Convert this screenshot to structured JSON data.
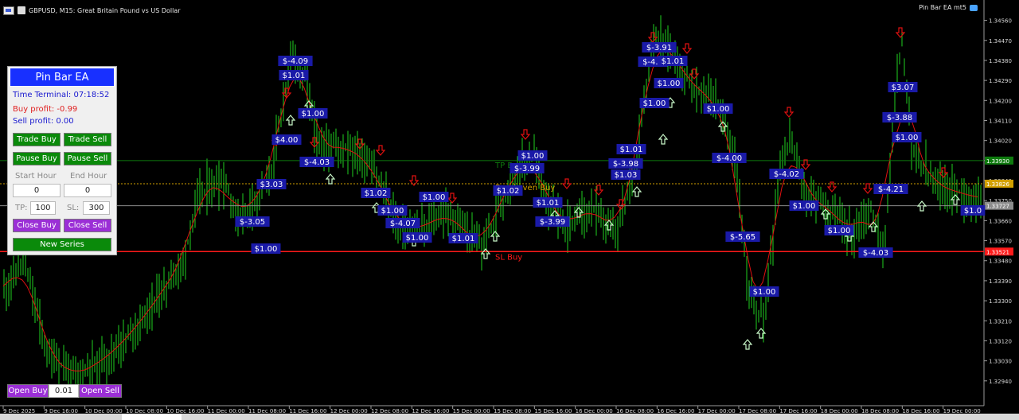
{
  "window": {
    "symbol_title": "GBPUSD, M15:  Great Britain Pound vs US Dollar",
    "ea_name": "Pin Bar EA mt5"
  },
  "colors": {
    "background": "#000000",
    "candle": "#1fd11f",
    "ma_line": "#e01010",
    "tp_line": "#0e7a0e",
    "sl_line": "#ff1a1a",
    "be_line": "#d2a000",
    "bid_line": "#8c8c8c",
    "profit_label_bg": "#1a1aa8",
    "panel_title_bg": "#1830ff",
    "button_green": "#0a8a0a",
    "button_purple": "#9b2fd6"
  },
  "price_axis": {
    "ticks": [
      "1.34560",
      "1.34470",
      "1.34380",
      "1.34290",
      "1.34200",
      "1.34110",
      "1.34020",
      "1.33930",
      "1.33840",
      "1.33750",
      "1.33660",
      "1.33570",
      "1.33480",
      "1.33390",
      "1.33300",
      "1.33210",
      "1.33120",
      "1.33030",
      "1.32940"
    ],
    "range": [
      1.329,
      1.3458
    ]
  },
  "time_axis": {
    "labels": [
      "9 Dec 2025",
      "9 Dec 16:00",
      "10 Dec 00:00",
      "10 Dec 08:00",
      "10 Dec 16:00",
      "11 Dec 00:00",
      "11 Dec 08:00",
      "11 Dec 16:00",
      "12 Dec 00:00",
      "12 Dec 08:00",
      "12 Dec 16:00",
      "15 Dec 00:00",
      "15 Dec 08:00",
      "15 Dec 16:00",
      "16 Dec 00:00",
      "16 Dec 08:00",
      "16 Dec 16:00",
      "17 Dec 00:00",
      "17 Dec 08:00",
      "17 Dec 16:00",
      "18 Dec 00:00",
      "18 Dec 08:00",
      "18 Dec 16:00",
      "19 Dec 00:00"
    ]
  },
  "levels": [
    {
      "name": "tp",
      "label": "TP Buy",
      "price": 1.3393,
      "badge": "1.33930",
      "color": "#0e7a0e"
    },
    {
      "name": "be",
      "label": "Breakeven Buy",
      "price": 1.33826,
      "badge": "1.33826",
      "color": "#d2a000"
    },
    {
      "name": "bid",
      "label": "",
      "price": 1.33727,
      "badge": "1.33727",
      "color": "#8c8c8c"
    },
    {
      "name": "sl",
      "label": "SL Buy",
      "price": 1.33521,
      "badge": "1.33521",
      "color": "#ff1a1a"
    }
  ],
  "profit_labels": [
    "$-4.09",
    "$1.01",
    "$1.00",
    "$4.00",
    "$-4.03",
    "$3.03",
    "$-3.05",
    "$1.00",
    "$1.02",
    "$1.00",
    "$-4.07",
    "$1.00",
    "$1.00",
    "$1.01",
    "$1.02",
    "$1.00",
    "$-3.99",
    "$1.01",
    "$-3.99",
    "$1.01",
    "$-3.98",
    "$1.03",
    "$-3.91",
    "$-4.0",
    "$1.01",
    "$1.00",
    "$1.00",
    "$1.00",
    "$-4.00",
    "$-5.65",
    "$1.00",
    "$-4.02",
    "$1.00",
    "$1.00",
    "$-4.21",
    "$-4.03",
    "$3.07",
    "$-3.88",
    "$1.00",
    "$1.0"
  ],
  "panel": {
    "title": "Pin Bar EA",
    "time_label": "Time Terminal: 07:18:52",
    "buy_profit": "Buy profit: -0.99",
    "sell_profit": "Sell profit: 0.00",
    "trade_buy": "Trade Buy",
    "trade_sell": "Trade Sell",
    "pause_buy": "Pause Buy",
    "pause_sell": "Pause Sell",
    "start_hour_label": "Start Hour",
    "end_hour_label": "End Hour",
    "start_hour": "0",
    "end_hour": "0",
    "tp_label": "TP:",
    "tp_value": "100",
    "sl_label": "SL:",
    "sl_value": "300",
    "close_buy": "Close Buy",
    "close_sell": "Close Sell",
    "new_series": "New Series"
  },
  "bottom": {
    "open_buy": "Open Buy",
    "lot": "0.01",
    "open_sell": "Open Sell"
  }
}
